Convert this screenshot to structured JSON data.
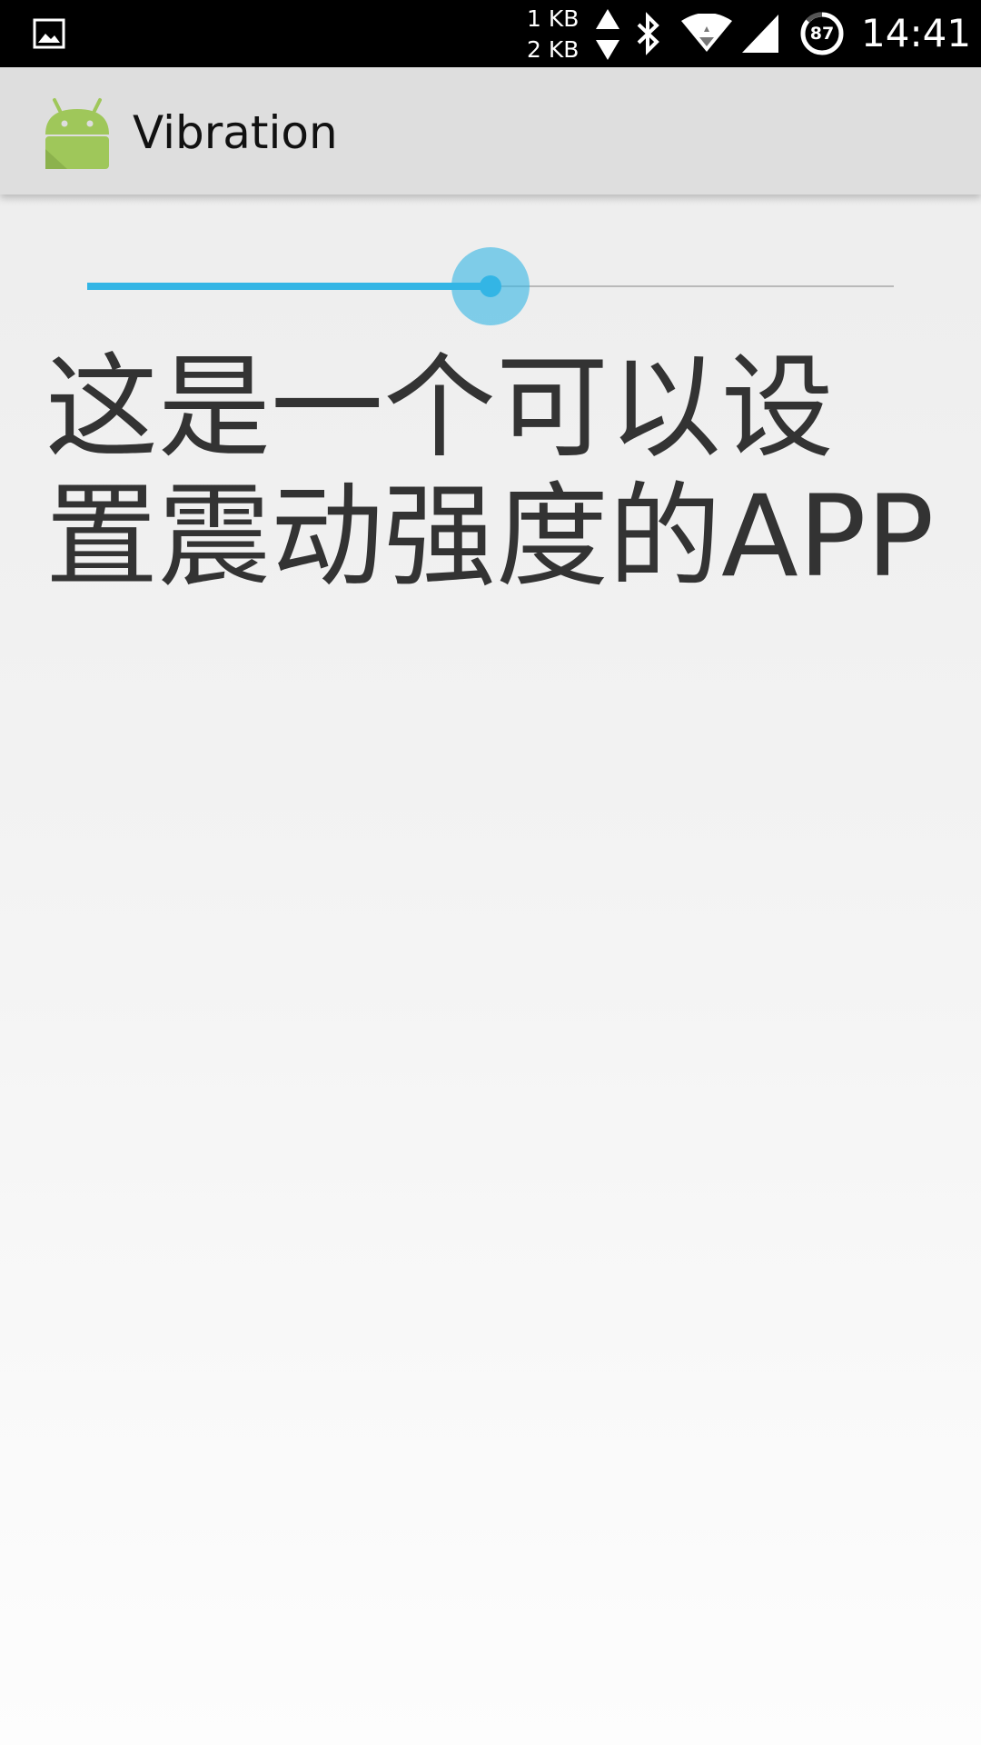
{
  "status_bar": {
    "gallery_icon": "image-icon",
    "upload_rate": "1 KB",
    "download_rate": "2 KB",
    "bluetooth_icon": "bluetooth-icon",
    "wifi_icon": "wifi-icon",
    "signal_icon": "cell-signal-icon",
    "battery_level": "87",
    "time": "14:41"
  },
  "app_bar": {
    "icon": "android-robot-icon",
    "title": "Vibration"
  },
  "seekbar": {
    "progress": 0.5,
    "accent_color": "#33b5e5"
  },
  "main": {
    "description": "这是一个可以设置震动强度的APP"
  }
}
